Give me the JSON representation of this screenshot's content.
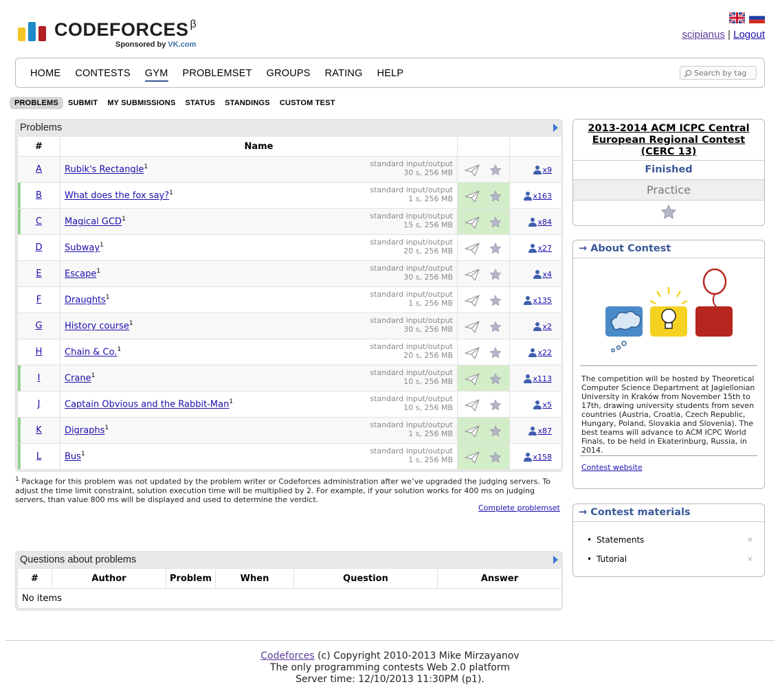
{
  "header": {
    "logo_text": "CODEFORCES",
    "logo_beta": "β",
    "sponsor_prefix": "Sponsored by ",
    "sponsor_brand": "VK.com",
    "user": "scipianus",
    "separator": "|",
    "logout": "Logout"
  },
  "menu": {
    "items": [
      "HOME",
      "CONTESTS",
      "GYM",
      "PROBLEMSET",
      "GROUPS",
      "RATING",
      "HELP"
    ],
    "active": "GYM",
    "search_placeholder": "Search by tag"
  },
  "subnav": {
    "items": [
      "PROBLEMS",
      "SUBMIT",
      "MY SUBMISSIONS",
      "STATUS",
      "STANDINGS",
      "CUSTOM TEST"
    ],
    "active": "PROBLEMS"
  },
  "problems": {
    "title": "Problems",
    "headers": {
      "num": "#",
      "name": "Name"
    },
    "rows": [
      {
        "idx": "A",
        "name": "Rubik's Rectangle",
        "sup": "1",
        "io": "standard input/output",
        "limits": "30 s, 256 MB",
        "solved": false,
        "count": "x9"
      },
      {
        "idx": "B",
        "name": "What does the fox say?",
        "sup": "1",
        "io": "standard input/output",
        "limits": "1 s, 256 MB",
        "solved": true,
        "count": "x163"
      },
      {
        "idx": "C",
        "name": "Magical GCD",
        "sup": "1",
        "io": "standard input/output",
        "limits": "15 s, 256 MB",
        "solved": true,
        "count": "x84"
      },
      {
        "idx": "D",
        "name": "Subway",
        "sup": "1",
        "io": "standard input/output",
        "limits": "20 s, 256 MB",
        "solved": false,
        "count": "x27"
      },
      {
        "idx": "E",
        "name": "Escape",
        "sup": "1",
        "io": "standard input/output",
        "limits": "30 s, 256 MB",
        "solved": false,
        "count": "x4"
      },
      {
        "idx": "F",
        "name": "Draughts",
        "sup": "1",
        "io": "standard input/output",
        "limits": "1 s, 256 MB",
        "solved": false,
        "count": "x135"
      },
      {
        "idx": "G",
        "name": "History course",
        "sup": "1",
        "io": "standard input/output",
        "limits": "30 s, 256 MB",
        "solved": false,
        "count": "x2"
      },
      {
        "idx": "H",
        "name": "Chain & Co.",
        "sup": "1",
        "io": "standard input/output",
        "limits": "20 s, 256 MB",
        "solved": false,
        "count": "x22"
      },
      {
        "idx": "I",
        "name": "Crane",
        "sup": "1",
        "io": "standard input/output",
        "limits": "10 s, 256 MB",
        "solved": true,
        "count": "x113"
      },
      {
        "idx": "J",
        "name": "Captain Obvious and the Rabbit-Man",
        "sup": "1",
        "io": "standard input/output",
        "limits": "10 s, 256 MB",
        "solved": false,
        "count": "x5"
      },
      {
        "idx": "K",
        "name": "Digraphs",
        "sup": "1",
        "io": "standard input/output",
        "limits": "1 s, 256 MB",
        "solved": true,
        "count": "x87"
      },
      {
        "idx": "L",
        "name": "Bus",
        "sup": "1",
        "io": "standard input/output",
        "limits": "1 s, 256 MB",
        "solved": true,
        "count": "x158"
      }
    ],
    "footnote_mark": "1",
    "footnote": "Package for this problem was not updated by the problem writer or Codeforces administration after we’ve upgraded the judging servers. To adjust the time limit constraint, solution execution time will be multiplied by 2. For example, if your solution works for 400 ms on judging servers, than value 800 ms will be displayed and used to determine the verdict.",
    "complete_link": "Complete problemset"
  },
  "questions": {
    "title": "Questions about problems",
    "headers": [
      "#",
      "Author",
      "Problem",
      "When",
      "Question",
      "Answer"
    ],
    "empty": "No items"
  },
  "contest": {
    "name": "2013-2014 ACM ICPC Central European Regional Contest (CERC 13)",
    "status": "Finished",
    "mode": "Practice"
  },
  "about": {
    "title": "→ About Contest",
    "text": "The competition will be hosted by Theoretical Computer Science Department at Jagiellonian University in Kraków from November 15th to 17th, drawing university students from seven countries (Austria, Croatia, Czech Republic, Hungary, Poland, Slovakia and Slovenia). The best teams will advance to ACM ICPC World Finals, to be held in Ekaterinburg, Russia, in 2014.",
    "website_link": "Contest website"
  },
  "materials": {
    "title": "→ Contest materials",
    "items": [
      "Statements",
      "Tutorial"
    ],
    "remove_glyph": "×"
  },
  "footer": {
    "brand": "Codeforces",
    "copyright": " (c) Copyright 2010-2013 Mike Mirzayanov",
    "tagline": "The only programming contests Web 2.0 platform",
    "server_time": "Server time: 12/10/2013 11:30PM (p1)."
  },
  "colors": {
    "solved_bg": "#d4edc9",
    "accent": "#3b5998",
    "link": "#1a0dab"
  }
}
